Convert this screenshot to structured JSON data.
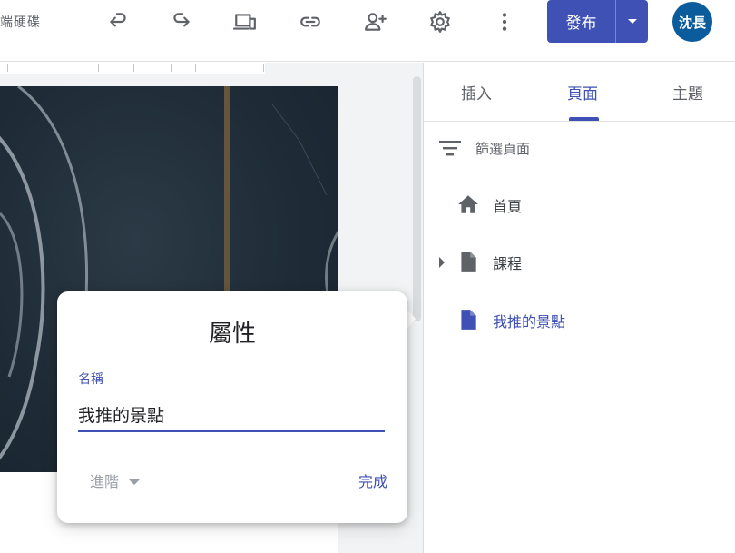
{
  "header": {
    "drive_label": "端硬碟",
    "publish_label": "發布",
    "avatar_text": "沈長"
  },
  "icons": [
    "undo-icon",
    "redo-icon",
    "preview-devices-icon",
    "insert-link-icon",
    "share-person-add-icon",
    "settings-gear-icon",
    "more-vert-icon",
    "chevron-down-icon"
  ],
  "popup": {
    "title": "屬性",
    "name_label": "名稱",
    "name_value": "我推的景點",
    "advanced_label": "進階",
    "done_label": "完成"
  },
  "panel": {
    "tabs": [
      {
        "label": "插入",
        "active": false
      },
      {
        "label": "頁面",
        "active": true
      },
      {
        "label": "主題",
        "active": false
      }
    ],
    "filter_placeholder": "篩選頁面",
    "pages": [
      {
        "label": "首頁",
        "icon": "home-icon"
      },
      {
        "label": "課程",
        "icon": "page-icon",
        "expandable": true
      },
      {
        "label": "我推的景點",
        "icon": "page-icon",
        "active": true
      }
    ]
  },
  "colors": {
    "accent": "#3f51b5",
    "avatar_bg": "#0b5c9c"
  }
}
